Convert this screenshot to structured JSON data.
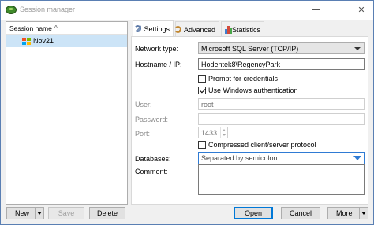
{
  "window": {
    "title": "Session manager",
    "controls": {
      "minimize": "",
      "maximize": "",
      "close": "✕"
    }
  },
  "session_list": {
    "column_header": "Session name",
    "sort_indicator": "^",
    "items": [
      {
        "label": "Nov21",
        "icon": "windows-icon",
        "selected": true
      }
    ]
  },
  "tabs": [
    {
      "label": "Settings",
      "icon": "wrench-icon",
      "active": true
    },
    {
      "label": "Advanced",
      "icon": "wrench-icon",
      "active": false
    },
    {
      "label": "Statistics",
      "icon": "bar-chart-icon",
      "active": false
    }
  ],
  "settings": {
    "network_type": {
      "label": "Network type:",
      "value": "Microsoft SQL Server (TCP/IP)"
    },
    "hostname": {
      "label": "Hostname / IP:",
      "value": "Hodentek8\\RegencyPark"
    },
    "prompt_credentials": {
      "label": "Prompt for credentials",
      "checked": false
    },
    "windows_auth": {
      "label": "Use Windows authentication",
      "checked": true
    },
    "user": {
      "label": "User:",
      "value": "root",
      "enabled": false
    },
    "password": {
      "label": "Password:",
      "value": "",
      "enabled": false
    },
    "port": {
      "label": "Port:",
      "value": "1433",
      "enabled": false
    },
    "compressed": {
      "label": "Compressed client/server protocol",
      "checked": false
    },
    "databases": {
      "label": "Databases:",
      "placeholder": "Separated by semicolon"
    },
    "comment": {
      "label": "Comment:",
      "value": ""
    }
  },
  "buttons": {
    "new": "New",
    "save": "Save",
    "delete": "Delete",
    "open": "Open",
    "cancel": "Cancel",
    "more": "More"
  },
  "colors": {
    "accent": "#0078d7",
    "selection": "#cce4f7",
    "window_border": "#5a7fb3"
  }
}
